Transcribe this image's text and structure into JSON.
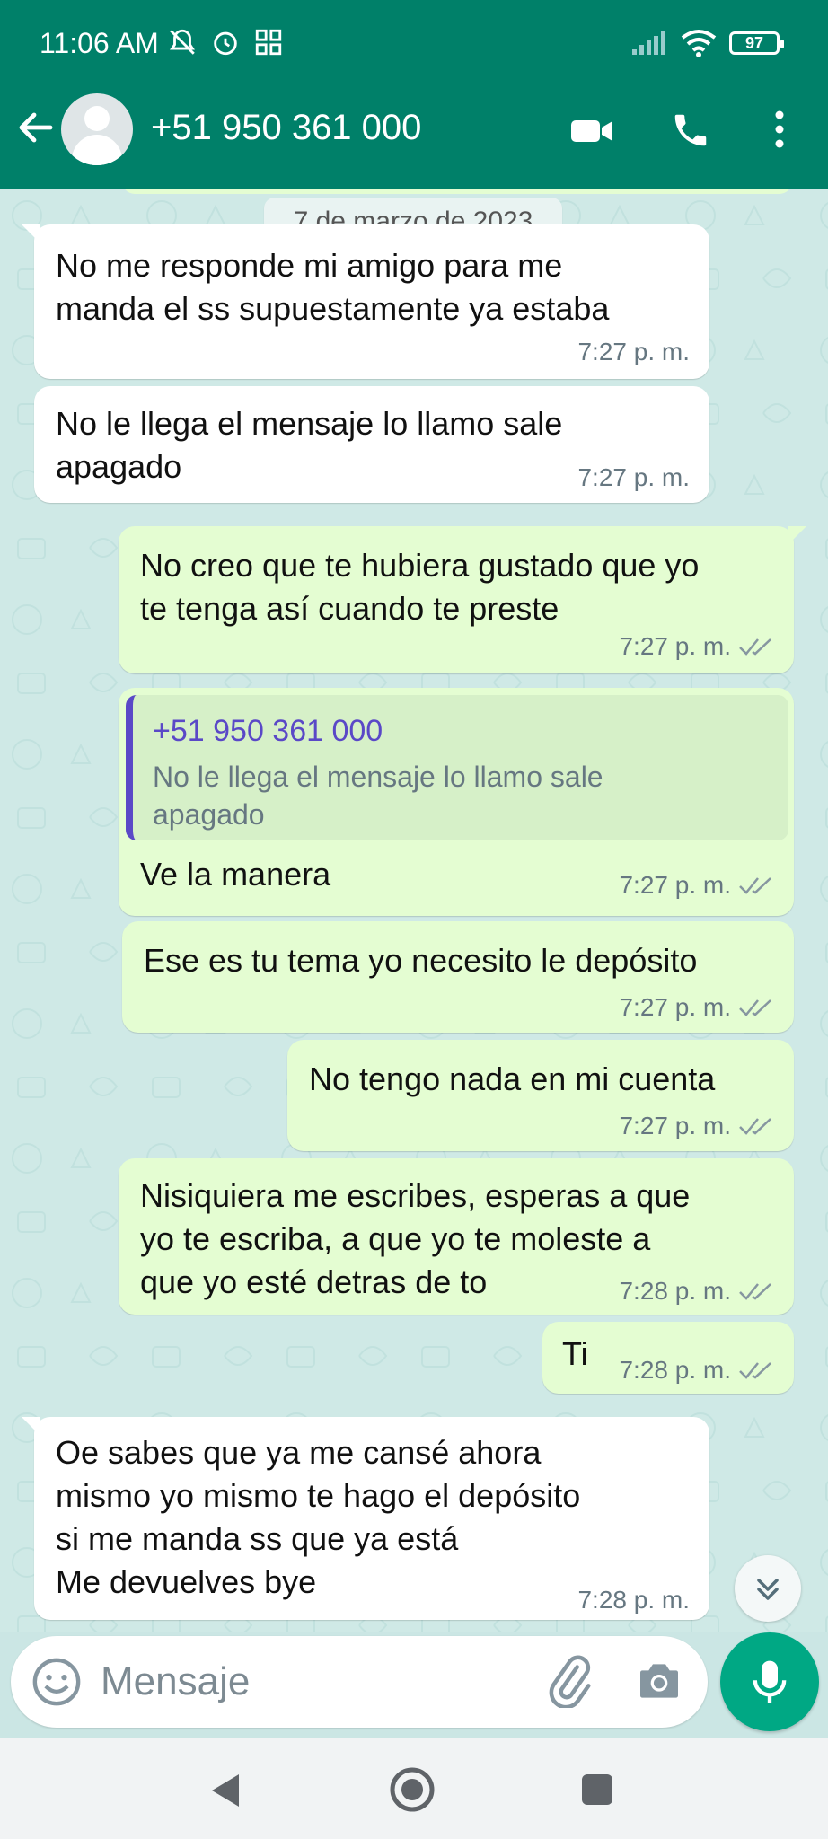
{
  "status_bar": {
    "time": "11:06 AM",
    "battery": "97",
    "icons": [
      "mute-bell-icon",
      "alarm-icon",
      "apps-grid-icon",
      "signal-icon",
      "wifi-icon",
      "battery-icon"
    ]
  },
  "header": {
    "contact": "+51 950 361 000",
    "icons": [
      "back-arrow-icon",
      "avatar-icon",
      "video-call-icon",
      "phone-call-icon",
      "more-vert-icon"
    ],
    "color": "#008069"
  },
  "chat": {
    "date": "7 de marzo de 2023",
    "messages": [
      {
        "dir": "in",
        "text": "No me responde mi amigo para me\nmanda el ss supuestamente ya estaba",
        "time": "7:27 p. m."
      },
      {
        "dir": "in",
        "text": "No le llega el mensaje lo llamo sale\napagado",
        "time": "7:27 p. m."
      },
      {
        "dir": "out",
        "text": "No creo que te hubiera gustado que yo\nte tenga así cuando te preste",
        "time": "7:27 p. m."
      },
      {
        "dir": "out",
        "quote_name": "+51 950 361 000",
        "quote_text": "No le llega el mensaje lo llamo sale\napagado",
        "text": "Ve la manera",
        "time": "7:27 p. m."
      },
      {
        "dir": "out",
        "text": "Ese es tu tema yo necesito le depósito",
        "time": "7:27 p. m."
      },
      {
        "dir": "out",
        "text": "No tengo nada en mi cuenta",
        "time": "7:27 p. m."
      },
      {
        "dir": "out",
        "text": "Nisiquiera me escribes, esperas a que\nyo te escriba, a que yo te moleste a\nque yo esté detras de to",
        "time": "7:28 p. m."
      },
      {
        "dir": "out",
        "text": "Ti",
        "time": "7:28 p. m."
      },
      {
        "dir": "in",
        "text": "Oe sabes que ya me cansé ahora\nmismo yo mismo te hago el depósito\nsi me manda ss que ya está\nMe devuelves bye",
        "time": "7:28 p. m."
      }
    ],
    "bubble_in_color": "#ffffff",
    "bubble_out_color": "#e4fdd2",
    "quote_accent": "#5a48c7"
  },
  "composer": {
    "placeholder": "Mensaje",
    "icons": [
      "emoji-icon",
      "attach-icon",
      "camera-icon",
      "mic-icon"
    ],
    "mic_color": "#00a884"
  },
  "nav_bar": {
    "icons": [
      "nav-back-icon",
      "nav-home-icon",
      "nav-recents-icon"
    ]
  }
}
